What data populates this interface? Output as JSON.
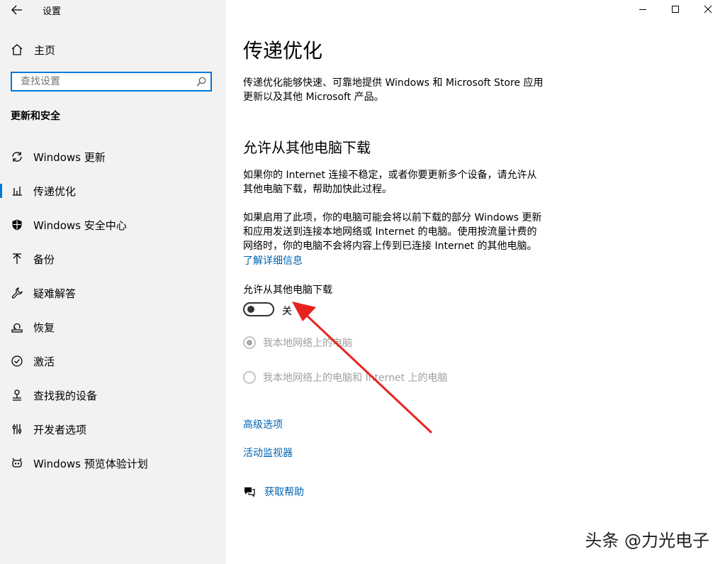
{
  "window": {
    "app_title": "设置",
    "controls": {
      "minimize": "minimize-icon",
      "maximize": "maximize-icon",
      "close": "close-icon"
    }
  },
  "sidebar": {
    "home_label": "主页",
    "search_placeholder": "查找设置",
    "section_title": "更新和安全",
    "items": [
      {
        "label": "Windows 更新",
        "icon": "sync-icon"
      },
      {
        "label": "传递优化",
        "icon": "delivery-optimization-icon",
        "selected": true
      },
      {
        "label": "Windows 安全中心",
        "icon": "shield-icon"
      },
      {
        "label": "备份",
        "icon": "backup-icon"
      },
      {
        "label": "疑难解答",
        "icon": "wrench-icon"
      },
      {
        "label": "恢复",
        "icon": "recovery-icon"
      },
      {
        "label": "激活",
        "icon": "check-circle-icon"
      },
      {
        "label": "查找我的设备",
        "icon": "find-device-icon"
      },
      {
        "label": "开发者选项",
        "icon": "developer-icon"
      },
      {
        "label": "Windows 预览体验计划",
        "icon": "insider-icon"
      }
    ],
    "accent_color": "#0078d7"
  },
  "main": {
    "title": "传递优化",
    "intro": [
      "传递优化能够快速、可靠地提供 Windows 和 Microsoft Store 应用",
      "更新以及其他 Microsoft 产品。"
    ],
    "subheading": "允许从其他电脑下载",
    "para1": [
      "如果你的 Internet 连接不稳定，或者你要更新多个设备，请允许从",
      "其他电脑下载，帮助加快此过程。"
    ],
    "para2": [
      "如果启用了此项，你的电脑可能会将以前下载的部分 Windows 更新",
      "和应用发送到连接本地网络或 Internet 的电脑。使用按流量计费的",
      "网络时，你的电脑不会将内容上传到已连接 Internet 的其他电脑。"
    ],
    "learn_more_link": "了解详细信息",
    "toggle": {
      "label": "允许从其他电脑下载",
      "state_text": "关",
      "on": false
    },
    "radio_options": [
      {
        "label": "我本地网络上的电脑",
        "checked": true,
        "disabled": true
      },
      {
        "label": "我本地网络上的电脑和 Internet 上的电脑",
        "checked": false,
        "disabled": true
      }
    ],
    "advanced_link": "高级选项",
    "monitor_link": "活动监视器",
    "help_link": "获取帮助",
    "link_color": "#0063b1"
  },
  "watermark": "头条 @力光电子",
  "annotation": {
    "arrow_color": "#e8231f"
  }
}
